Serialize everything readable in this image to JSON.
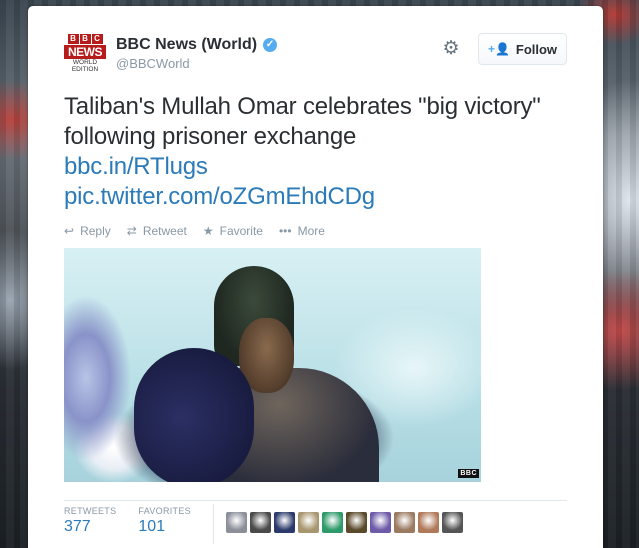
{
  "tweet": {
    "author": {
      "avatar_top": [
        "B",
        "B",
        "C"
      ],
      "avatar_news": "NEWS",
      "avatar_edition_1": "WORLD",
      "avatar_edition_2": "EDITION",
      "full_name": "BBC News (World)",
      "screen_name": "@BBCWorld",
      "verified_glyph": "✓"
    },
    "follow_label": "Follow",
    "text": "Taliban's Mullah Omar celebrates \"big victory\" following prisoner exchange",
    "link1": "bbc.in/RTlugs",
    "link2": "pic.twitter.com/oZGmEhdCDg",
    "actions": {
      "reply": "Reply",
      "retweet": "Retweet",
      "favorite": "Favorite",
      "more": "More"
    },
    "media_watermark": "BBC",
    "stats": {
      "retweets_label": "RETWEETS",
      "retweets_value": "377",
      "favorites_label": "FAVORITES",
      "favorites_value": "101"
    },
    "favoriter_avatar_colors": [
      "#8a8f99",
      "#4a4a4a",
      "#2b3a6b",
      "#a8966e",
      "#2e9a6a",
      "#5a4a2a",
      "#6d5aa8",
      "#9a7a60",
      "#b07a5a",
      "#555555"
    ]
  },
  "colors": {
    "link": "#2b7bb9",
    "verified": "#55acee",
    "muted": "#8899a6",
    "text": "#292f33",
    "bbc_red": "#b71c1c"
  }
}
